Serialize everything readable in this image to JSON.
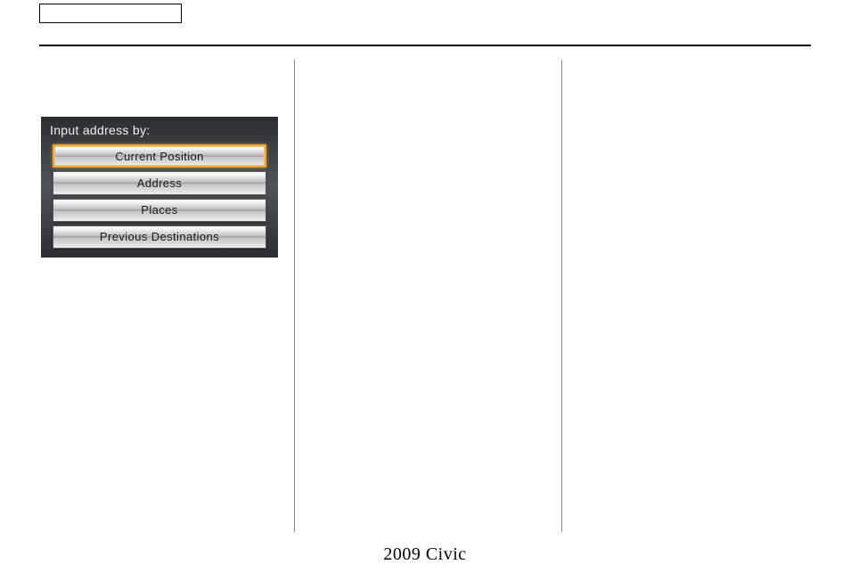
{
  "nav_panel": {
    "header": "Input address by:",
    "buttons": [
      {
        "label": "Current Position",
        "selected": true
      },
      {
        "label": "Address",
        "selected": false
      },
      {
        "label": "Places",
        "selected": false
      },
      {
        "label": "Previous Destinations",
        "selected": false
      }
    ]
  },
  "footer": "2009  Civic"
}
